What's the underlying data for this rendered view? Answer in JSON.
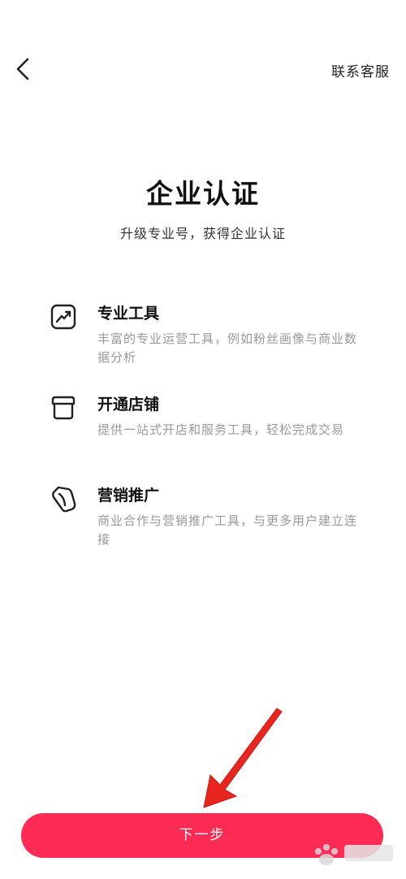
{
  "header": {
    "back_icon": "chevron-left-icon",
    "service_label": "联系客服"
  },
  "hero": {
    "title": "企业认证",
    "subtitle": "升级专业号，获得企业认证"
  },
  "features": [
    {
      "icon": "trend-chart-icon",
      "title": "专业工具",
      "desc": "丰富的专业运营工具，例如粉丝画像与商业数据分析"
    },
    {
      "icon": "store-icon",
      "title": "开通店铺",
      "desc": "提供一站式开店和服务工具，轻松完成交易"
    },
    {
      "icon": "tag-icon",
      "title": "营销推广",
      "desc": "商业合作与营销推广工具，与更多用户建立连接"
    }
  ],
  "footer": {
    "next_label": "下一步"
  },
  "colors": {
    "accent": "#fe2c55",
    "annotation_arrow": "#e8251f"
  }
}
